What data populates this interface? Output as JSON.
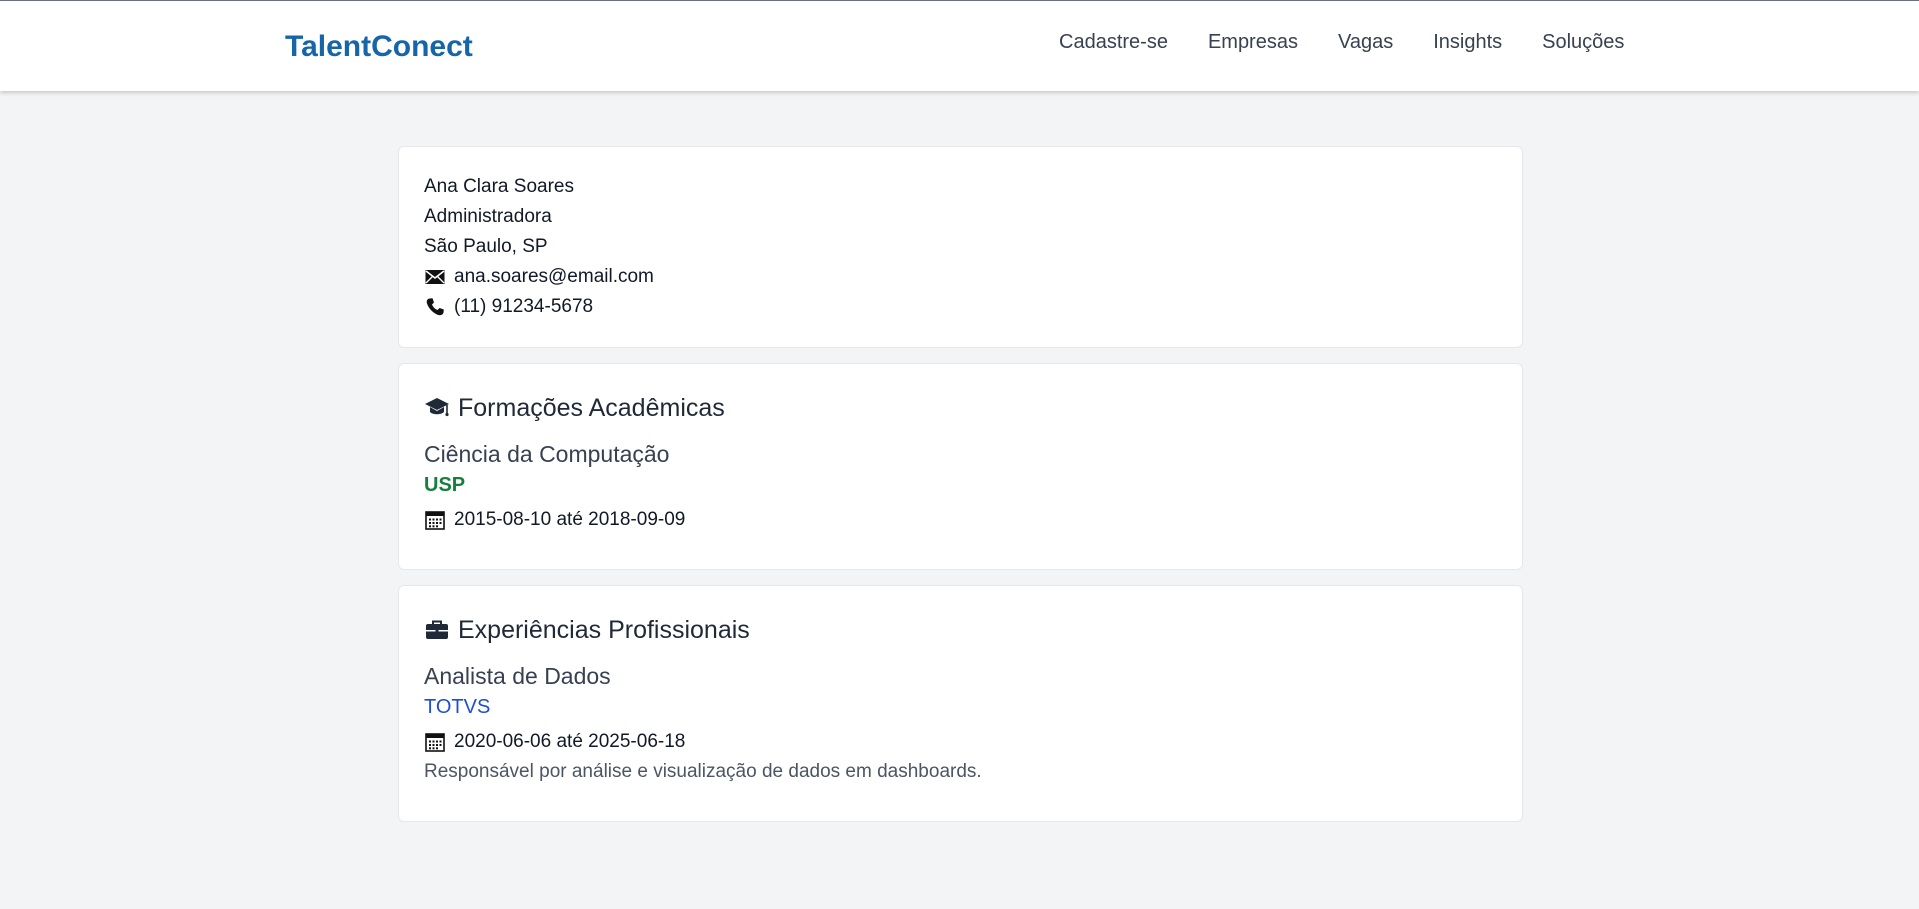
{
  "header": {
    "brand": "TalentConect",
    "nav": [
      "Cadastre-se",
      "Empresas",
      "Vagas",
      "Insights",
      "Soluções"
    ]
  },
  "profile": {
    "name": "Ana Clara Soares",
    "role": "Administradora",
    "location": "São Paulo, SP",
    "email": "ana.soares@email.com",
    "phone": "(11) 91234-5678",
    "email_icon": "envelope-icon",
    "phone_icon": "phone-icon"
  },
  "education": {
    "title": "Formações Acadêmicas",
    "icon": "graduation-cap-icon",
    "items": [
      {
        "course": "Ciência da Computação",
        "institution": "USP",
        "period": "2015-08-10 até 2018-09-09"
      }
    ]
  },
  "experience": {
    "title": "Experiências Profissionais",
    "icon": "briefcase-icon",
    "items": [
      {
        "position": "Analista de Dados",
        "company": "TOTVS",
        "period": "2020-06-06 até 2025-06-18",
        "description": "Responsável por análise e visualização de dados em dashboards."
      }
    ]
  },
  "colors": {
    "brand": "#1565a8",
    "institution": "#15803d",
    "company": "#1d4ed8",
    "background": "#f3f4f6"
  }
}
